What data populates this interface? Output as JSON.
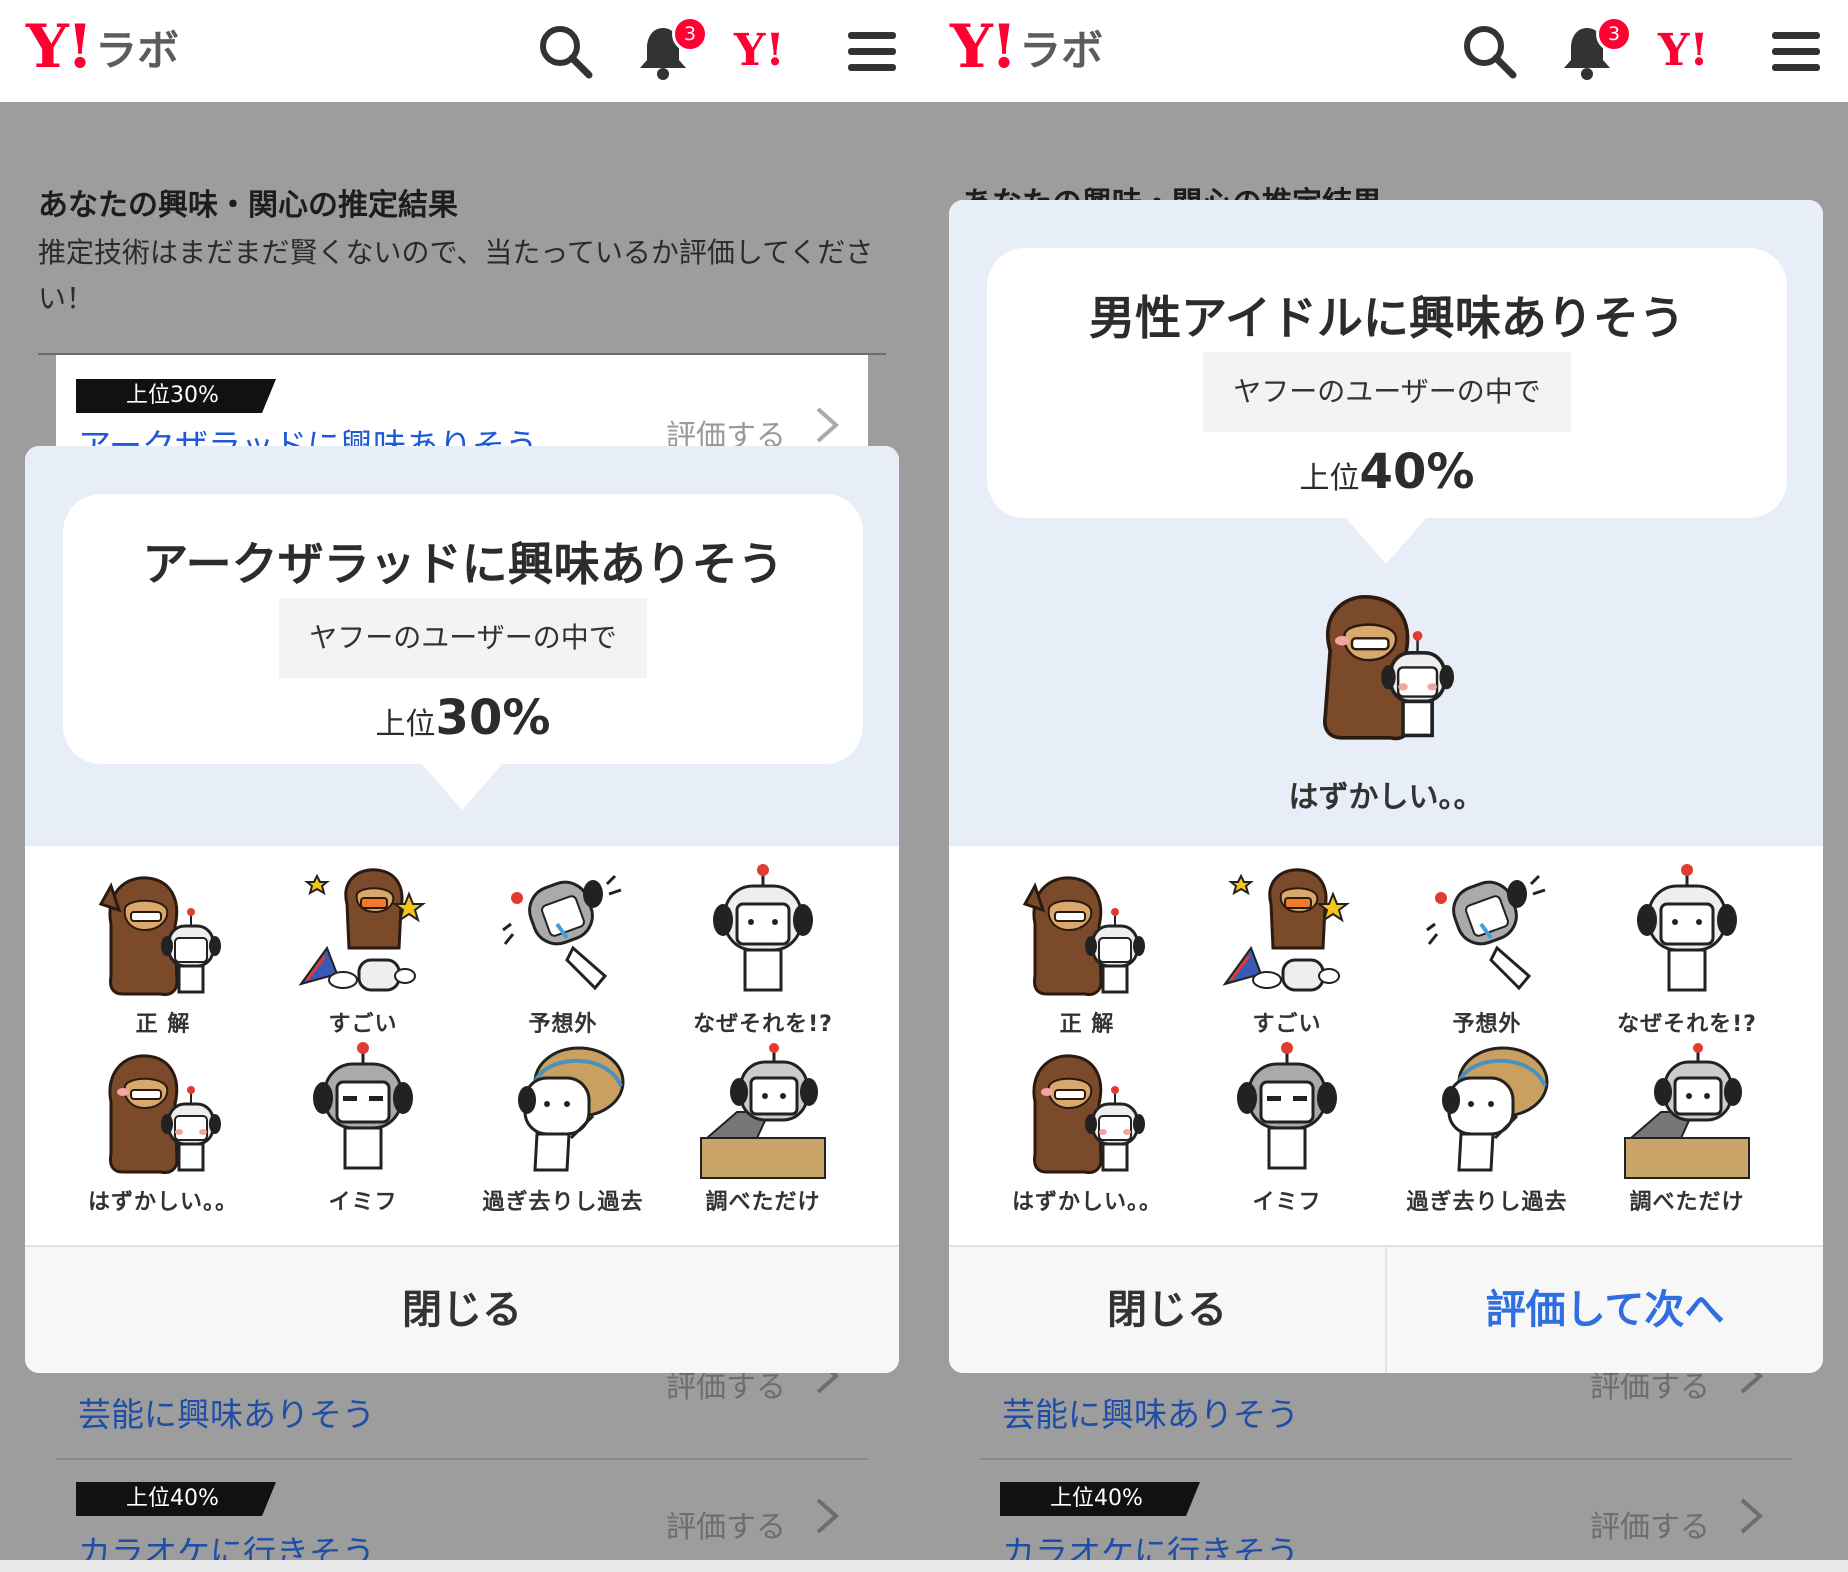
{
  "header": {
    "logo_mark": "Y!",
    "logo_text": "ラボ",
    "notification_count": "3",
    "yahoo_mark": "Y!"
  },
  "page": {
    "title": "あなたの興味・関心の推定結果",
    "description": "推定技術はまだまだ賢くないので、当たっているか評価してください！",
    "title_partial_right": "あなたの興味・関心の推定結果"
  },
  "rows": {
    "first": {
      "rank": "上位30%",
      "text": "アークザラッドに興味ありそう",
      "eval": "評価する"
    },
    "second": {
      "text": "芸能に興味ありそう",
      "eval": "評価する"
    },
    "third": {
      "rank": "上位40%",
      "text": "カラオケに行きそう",
      "eval": "評価する"
    }
  },
  "modal_left": {
    "title": "アークザラッドに興味ありそう",
    "subtitle": "ヤフーのユーザーの中で",
    "rank_prefix": "上位",
    "rank_value": "30%",
    "close_label": "閉じる"
  },
  "modal_right": {
    "title": "男性アイドルに興味ありそう",
    "subtitle": "ヤフーのユーザーの中で",
    "rank_prefix": "上位",
    "rank_value": "40%",
    "selected_label": "はずかしい。。",
    "close_label": "閉じる",
    "next_label": "評価して次へ"
  },
  "stickers": [
    {
      "label": "正 解",
      "icon": "gorilla-robot-pointing-icon"
    },
    {
      "label": "すごい",
      "icon": "gorilla-fireworks-icon"
    },
    {
      "label": "予想外",
      "icon": "robot-surprised-icon"
    },
    {
      "label": "なぜそれを!?",
      "icon": "robot-headphones-icon"
    },
    {
      "label": "はずかしい。。",
      "icon": "gorilla-robot-blush-icon"
    },
    {
      "label": "イミフ",
      "icon": "robot-squint-icon"
    },
    {
      "label": "過ぎ去りし過去",
      "icon": "robot-straw-hat-icon"
    },
    {
      "label": "調べただけ",
      "icon": "robot-laptop-icon"
    }
  ],
  "colors": {
    "brand_red": "#ff0033",
    "link_blue": "#1f5ad6",
    "next_blue": "#2f6fe0",
    "modal_bg_blue": "#e8eef7",
    "overlay_grey": "#9d9d9d",
    "gorilla_brown": "#7b4a2a"
  }
}
